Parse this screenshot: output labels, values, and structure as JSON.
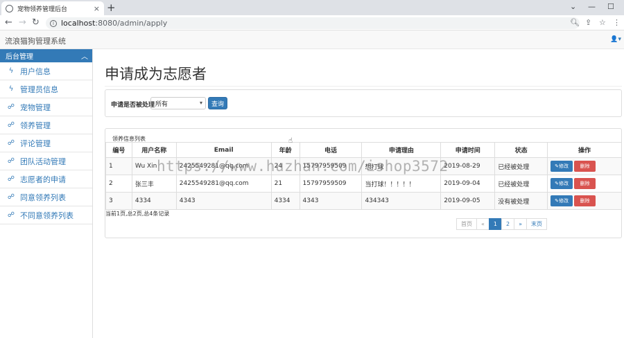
{
  "browser": {
    "tab_title": "宠物领养管理后台",
    "tab_close": "×",
    "new_tab": "+",
    "url_host": "localhost",
    "url_path": ":8080/admin/apply",
    "win_min": "—",
    "win_max": "☐",
    "chevron": "⌄"
  },
  "header": {
    "brand": "流浪猫狗管理系统",
    "user_menu": "👤▾"
  },
  "sidebar": {
    "title": "后台管理",
    "items": [
      {
        "label": "用户信息",
        "icon": "bolt-icon"
      },
      {
        "label": "管理员信息",
        "icon": "bolt-icon"
      },
      {
        "label": "宠物管理",
        "icon": "sitemap-icon"
      },
      {
        "label": "领养管理",
        "icon": "sitemap-icon"
      },
      {
        "label": "评论管理",
        "icon": "sitemap-icon"
      },
      {
        "label": "团队活动管理",
        "icon": "sitemap-icon"
      },
      {
        "label": "志愿者的申请",
        "icon": "sitemap-icon"
      },
      {
        "label": "同意领养列表",
        "icon": "sitemap-icon"
      },
      {
        "label": "不同意领养列表",
        "icon": "sitemap-icon"
      }
    ]
  },
  "main": {
    "title": "申请成为志愿者",
    "filter": {
      "label": "申请是否被处理",
      "selected": "所有",
      "button": "查询"
    },
    "list": {
      "heading": "领养信息列表",
      "columns": [
        "编号",
        "用户名称",
        "Email",
        "年龄",
        "电话",
        "申请理由",
        "申请时间",
        "状态",
        "操作"
      ],
      "rows": [
        {
          "id": "1",
          "name": "Wu Xin",
          "email": "2425549281@qq.com",
          "age": "24",
          "phone": "15797959509",
          "reason": "想打球",
          "date": "2019-08-29",
          "status": "已经被处理"
        },
        {
          "id": "2",
          "name": "张三丰",
          "email": "2425549281@qq.com",
          "age": "21",
          "phone": "15797959509",
          "reason": "当打球！！！！！",
          "date": "2019-09-04",
          "status": "已经被处理"
        },
        {
          "id": "3",
          "name": "4334",
          "email": "4343",
          "age": "4334",
          "phone": "4343",
          "reason": "434343",
          "date": "2019-09-05",
          "status": "没有被处理"
        }
      ],
      "edit_label": "✎修改",
      "delete_label": "删除",
      "summary": "当前1页,总2页,总4条记录",
      "pager": {
        "first": "首页",
        "prev": "«",
        "p1": "1",
        "p2": "2",
        "next": "»",
        "last": "末页"
      }
    },
    "watermark": "https://www.huzhan.com/ishop3572"
  }
}
